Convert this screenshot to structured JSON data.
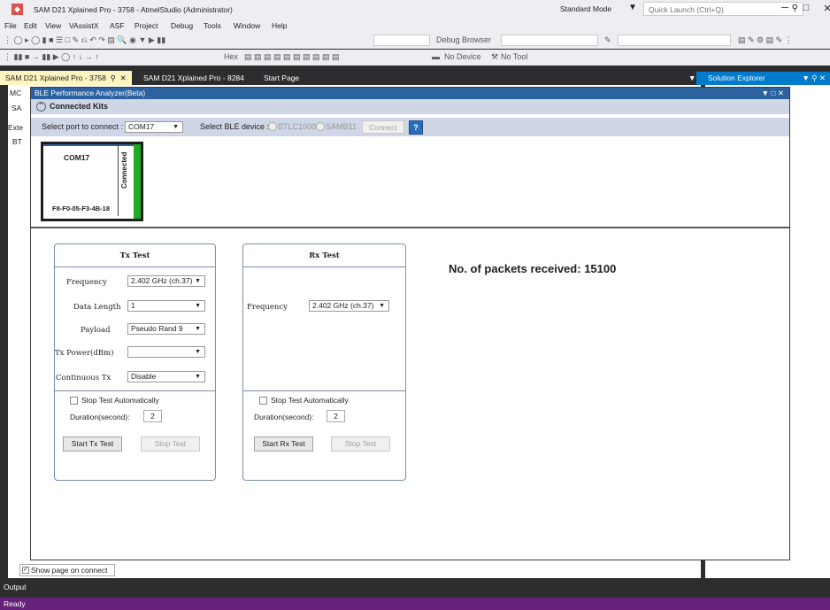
{
  "window": {
    "title": "SAM D21 Xplained Pro - 3758 - AtmelStudio (Administrator)",
    "mode": "Standard Mode",
    "quick_launch_placeholder": "Quick Launch (Ctrl+Q)"
  },
  "menu": [
    "File",
    "Edit",
    "View",
    "VAssistX",
    "ASF",
    "Project",
    "Debug",
    "Tools",
    "Window",
    "Help"
  ],
  "toolbar": {
    "debug_browser": "Debug Browser",
    "hex": "Hex",
    "no_device": "No Device",
    "no_tool": "No Tool"
  },
  "tabs": {
    "active": "SAM D21 Xplained Pro - 3758",
    "second": "SAM D21 Xplained Pro - 8284",
    "third": "Start Page",
    "solution_explorer": "Solution Explorer"
  },
  "doc_fragments": {
    "mc": "MC",
    "sa": "SA",
    "exte": "Exte",
    "bt": "BT"
  },
  "ble": {
    "window_title": "BLE Performance Analyzer(Beta)",
    "connected_kits": "Connected Kits",
    "select_port_label": "Select port to connect :",
    "port_value": "COM17",
    "select_device_label": "Select BLE device :",
    "device_opt1": "BTLC1000",
    "device_opt2": "SAMB11",
    "connect_label": "Connect",
    "kit": {
      "port": "COM17",
      "status": "Connected",
      "address": "F8-F0-05-F3-4B-18"
    },
    "tx": {
      "title": "Tx Test",
      "frequency_label": "Frequency",
      "frequency_value": "2.402 GHz (ch.37)",
      "data_length_label": "Data Length",
      "data_length_value": "1",
      "payload_label": "Payload",
      "payload_value": "Pseudo Rand 9",
      "tx_power_label": "Tx Power(dBm)",
      "tx_power_value": "",
      "continuous_label": "Continuous Tx",
      "continuous_value": "Disable",
      "stop_auto_label": "Stop Test Automatically",
      "duration_label": "Duration(second):",
      "duration_value": "2",
      "start_label": "Start Tx Test",
      "stop_label": "Stop Test"
    },
    "rx": {
      "title": "Rx Test",
      "frequency_label": "Frequency",
      "frequency_value": "2.402 GHz (ch.37)",
      "stop_auto_label": "Stop Test Automatically",
      "duration_label": "Duration(second):",
      "duration_value": "2",
      "start_label": "Start Rx Test",
      "stop_label": "Stop Test"
    },
    "packets_label": "No. of packets received:",
    "packets_value": "15100"
  },
  "show_page_label": "Show page on connect",
  "output_label": "Output",
  "status_text": "Ready",
  "colors": {
    "status_bar": "#68217a",
    "accent": "#007acc",
    "active_tab": "#fdf4bf"
  }
}
